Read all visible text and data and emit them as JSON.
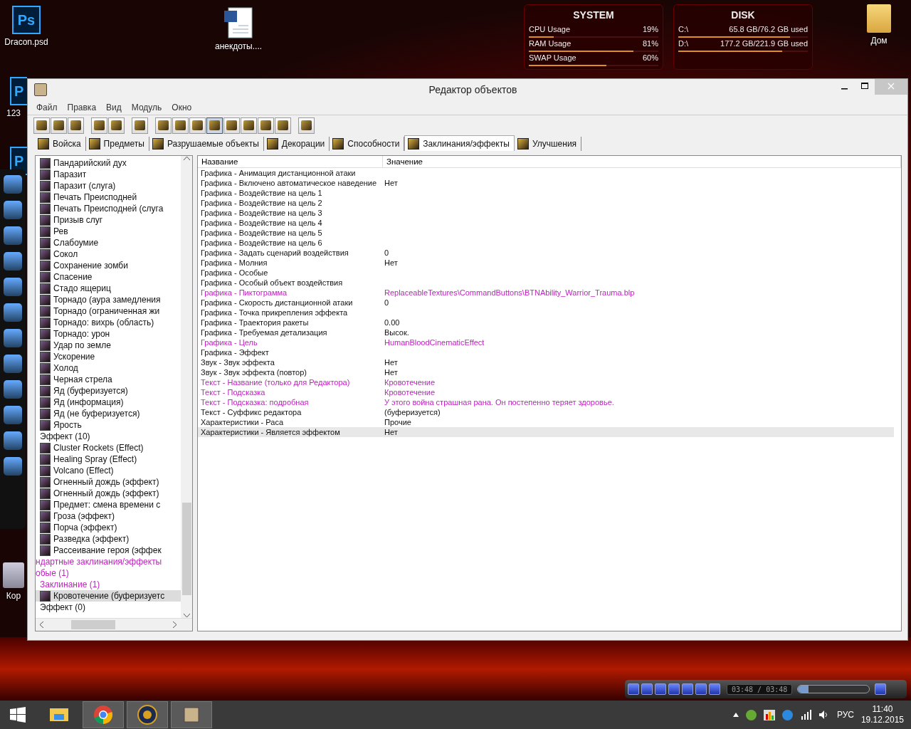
{
  "desktop_icons": [
    {
      "kind": "ps",
      "badge": "Ps",
      "label": "Dracon.psd"
    },
    {
      "kind": "word",
      "label": "анекдоты...."
    },
    {
      "kind": "folder",
      "label": "Дом"
    },
    {
      "kind": "ps",
      "badge": "P",
      "label": "123"
    },
    {
      "kind": "ps",
      "badge": "P"
    },
    {
      "kind": "bin",
      "label": "Кор"
    }
  ],
  "system_widget": {
    "title": "SYSTEM",
    "rows": [
      {
        "label": "CPU Usage",
        "value": "19%",
        "level": 0.19
      },
      {
        "label": "RAM Usage",
        "value": "81%",
        "level": 0.81
      },
      {
        "label": "SWAP Usage",
        "value": "60%",
        "level": 0.6
      }
    ]
  },
  "disk_widget": {
    "title": "DISK",
    "rows": [
      {
        "label": "C:\\",
        "value": "65.8 GB/76.2 GB used",
        "level": 0.86
      },
      {
        "label": "D:\\",
        "value": "177.2 GB/221.9 GB used",
        "level": 0.8
      }
    ]
  },
  "window": {
    "title": "Редактор объектов"
  },
  "menu": [
    "Файл",
    "Правка",
    "Вид",
    "Модуль",
    "Окно"
  ],
  "toolbar": [
    [
      {
        "selected": false
      },
      {
        "selected": false
      },
      {
        "selected": false
      }
    ],
    [
      {
        "selected": false
      },
      {
        "selected": false
      }
    ],
    [
      {
        "selected": false
      }
    ],
    [
      {
        "selected": false
      },
      {
        "selected": false
      },
      {
        "selected": false
      },
      {
        "selected": true
      },
      {
        "selected": false
      },
      {
        "selected": false
      },
      {
        "selected": false
      },
      {
        "selected": false
      }
    ],
    [
      {
        "selected": false
      }
    ]
  ],
  "tabs": [
    {
      "label": "Войска",
      "selected": false
    },
    {
      "label": "Предметы",
      "selected": false
    },
    {
      "label": "Разрушаемые объекты",
      "selected": false
    },
    {
      "label": "Декорации",
      "selected": false
    },
    {
      "label": "Способности",
      "selected": false
    },
    {
      "label": "Заклинания/эффекты",
      "selected": true
    },
    {
      "label": "Улучшения",
      "selected": false
    }
  ],
  "tree": [
    {
      "kind": "group",
      "children": [
        {
          "kind": "group",
          "children": [
            {
              "kind": "group",
              "children": [
                {
                  "kind": "item",
                  "label": "Пандарийский дух",
                  "selected": false
                },
                {
                  "kind": "item",
                  "label": "Паразит",
                  "selected": false
                },
                {
                  "kind": "item",
                  "label": "Паразит (слуга)",
                  "selected": false
                },
                {
                  "kind": "item",
                  "label": "Печать Преисподней",
                  "selected": false
                },
                {
                  "kind": "item",
                  "label": "Печать Преисподней (слуга",
                  "selected": false
                },
                {
                  "kind": "item",
                  "label": "Призыв слуг",
                  "selected": false
                },
                {
                  "kind": "item",
                  "label": "Рев",
                  "selected": false
                },
                {
                  "kind": "item",
                  "label": "Слабоумие",
                  "selected": false
                },
                {
                  "kind": "item",
                  "label": "Сокол",
                  "selected": false
                },
                {
                  "kind": "item",
                  "label": "Сохранение зомби",
                  "selected": false
                },
                {
                  "kind": "item",
                  "label": "Спасение",
                  "selected": false
                },
                {
                  "kind": "item",
                  "label": "Стадо ящериц",
                  "selected": false
                },
                {
                  "kind": "item",
                  "label": "Торнадо (аура замедления",
                  "selected": false
                },
                {
                  "kind": "item",
                  "label": "Торнадо (ограниченная жи",
                  "selected": false
                },
                {
                  "kind": "item",
                  "label": "Торнадо: вихрь (область)",
                  "selected": false
                },
                {
                  "kind": "item",
                  "label": "Торнадо: урон",
                  "selected": false
                },
                {
                  "kind": "item",
                  "label": "Удар по земле",
                  "selected": false
                },
                {
                  "kind": "item",
                  "label": "Ускорение",
                  "selected": false
                },
                {
                  "kind": "item",
                  "label": "Холод",
                  "selected": false
                },
                {
                  "kind": "item",
                  "label": "Черная стрела",
                  "selected": false
                },
                {
                  "kind": "item",
                  "label": "Яд (буферизуется)",
                  "selected": false
                },
                {
                  "kind": "item",
                  "label": "Яд (информация)",
                  "selected": false
                },
                {
                  "kind": "item",
                  "label": "Яд (не буферизуется)",
                  "selected": false
                },
                {
                  "kind": "item",
                  "label": "Ярость",
                  "selected": false
                }
              ]
            },
            {
              "kind": "folder",
              "label": "Эффект (10)",
              "custom": false,
              "selected": false,
              "children": [
                {
                  "kind": "item",
                  "label": "Cluster Rockets (Effect)",
                  "selected": false
                },
                {
                  "kind": "item",
                  "label": "Healing Spray (Effect)",
                  "selected": false
                },
                {
                  "kind": "item",
                  "label": "Volcano (Effect)",
                  "selected": false
                },
                {
                  "kind": "item",
                  "label": "Огненный дождь (эффект)",
                  "selected": false
                },
                {
                  "kind": "item",
                  "label": "Огненный дождь (эффект)",
                  "selected": false
                },
                {
                  "kind": "item",
                  "label": "Предмет: смена времени с",
                  "selected": false
                },
                {
                  "kind": "item",
                  "label": "Гроза (эффект)",
                  "selected": false
                },
                {
                  "kind": "item",
                  "label": "Порча (эффект)",
                  "selected": false
                },
                {
                  "kind": "item",
                  "label": "Разведка (эффект)",
                  "selected": false
                },
                {
                  "kind": "item",
                  "label": "Рассеивание героя (эффек",
                  "selected": false
                }
              ]
            }
          ]
        }
      ]
    },
    {
      "kind": "folder",
      "label": "ндартные заклинания/эффекты",
      "custom": true,
      "selected": false,
      "children": [
        {
          "kind": "folder",
          "label": "обые (1)",
          "custom": true,
          "selected": false,
          "children": [
            {
              "kind": "folder",
              "label": "Заклинание (1)",
              "custom": true,
              "selected": false,
              "children": [
                {
                  "kind": "item",
                  "label": "Кровотечение (буферизуетс",
                  "selected": true
                }
              ]
            },
            {
              "kind": "folder",
              "label": "Эффект (0)",
              "custom": false,
              "selected": false
            }
          ]
        }
      ]
    }
  ],
  "table": {
    "columns": [
      "Название",
      "Значение"
    ],
    "rows": [
      {
        "name": "Графика - Анимация дистанционной атаки",
        "value": "",
        "modified": false,
        "selected": false
      },
      {
        "name": "Графика - Включено автоматическое наведение",
        "value": "Нет",
        "modified": false,
        "selected": false
      },
      {
        "name": "Графика - Воздействие на цель 1",
        "value": "",
        "modified": false,
        "selected": false
      },
      {
        "name": "Графика - Воздействие на цель 2",
        "value": "",
        "modified": false,
        "selected": false
      },
      {
        "name": "Графика - Воздействие на цель 3",
        "value": "",
        "modified": false,
        "selected": false
      },
      {
        "name": "Графика - Воздействие на цель 4",
        "value": "",
        "modified": false,
        "selected": false
      },
      {
        "name": "Графика - Воздействие на цель 5",
        "value": "",
        "modified": false,
        "selected": false
      },
      {
        "name": "Графика - Воздействие на цель 6",
        "value": "",
        "modified": false,
        "selected": false
      },
      {
        "name": "Графика - Задать сценарий воздействия",
        "value": "0",
        "modified": false,
        "selected": false
      },
      {
        "name": "Графика - Молния",
        "value": "Нет",
        "modified": false,
        "selected": false
      },
      {
        "name": "Графика - Особые",
        "value": "",
        "modified": false,
        "selected": false
      },
      {
        "name": "Графика - Особый объект воздействия",
        "value": "",
        "modified": false,
        "selected": false
      },
      {
        "name": "Графика - Пиктограмма",
        "value": "ReplaceableTextures\\CommandButtons\\BTNAbility_Warrior_Trauma.blp",
        "modified": true,
        "selected": false
      },
      {
        "name": "Графика - Скорость дистанционной атаки",
        "value": "0",
        "modified": false,
        "selected": false
      },
      {
        "name": "Графика - Точка прикрепления эффекта",
        "value": "",
        "modified": false,
        "selected": false
      },
      {
        "name": "Графика - Траектория ракеты",
        "value": "0.00",
        "modified": false,
        "selected": false
      },
      {
        "name": "Графика - Требуемая детализация",
        "value": "Высок.",
        "modified": false,
        "selected": false
      },
      {
        "name": "Графика - Цель",
        "value": "HumanBloodCinematicEffect",
        "modified": true,
        "selected": false
      },
      {
        "name": "Графика - Эффект",
        "value": "",
        "modified": false,
        "selected": false
      },
      {
        "name": "Звук - Звук эффекта",
        "value": "Нет",
        "modified": false,
        "selected": false
      },
      {
        "name": "Звук - Звук эффекта (повтор)",
        "value": "Нет",
        "modified": false,
        "selected": false
      },
      {
        "name": "Текст - Название (только для Редактора)",
        "value": "Кровотечение",
        "modified": true,
        "selected": false
      },
      {
        "name": "Текст - Подсказка",
        "value": "Кровотечение",
        "modified": true,
        "selected": false
      },
      {
        "name": "Текст - Подсказка: подробная",
        "value": "У этого война страшная рана. Он постепенно теряет здоровье.",
        "modified": true,
        "selected": false
      },
      {
        "name": "Текст - Суффикс редактора",
        "value": " (буферизуется)",
        "modified": false,
        "selected": false
      },
      {
        "name": "Характеристики - Раса",
        "value": "Прочие",
        "modified": false,
        "selected": false
      },
      {
        "name": "Характеристики - Является эффектом",
        "value": "Нет",
        "modified": false,
        "selected": true
      }
    ]
  },
  "media_player": {
    "time": "03:48 / 03:48",
    "level": 0.15
  },
  "taskbar": {
    "apps": [
      {
        "kind": "explorer",
        "selected": false
      },
      {
        "kind": "chrome",
        "selected": true
      },
      {
        "kind": "game",
        "selected": true
      },
      {
        "kind": "editor",
        "selected": true
      }
    ],
    "language": "РУС",
    "time": "11:40",
    "date": "19.12.2015"
  }
}
